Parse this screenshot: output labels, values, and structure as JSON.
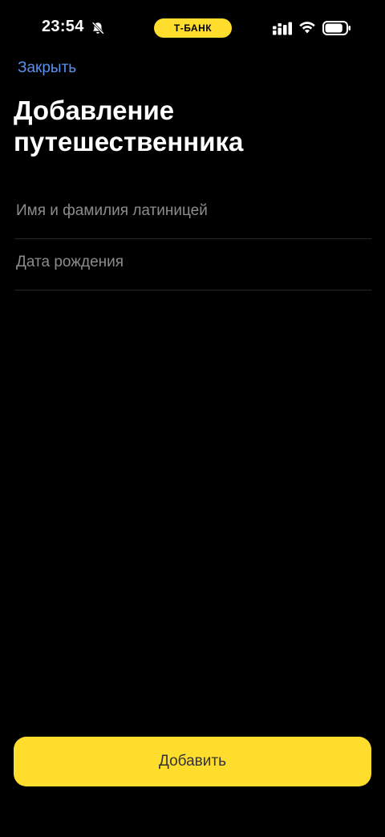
{
  "status_bar": {
    "time": "23:54",
    "bell_icon": "bell-slash-icon",
    "island_label": "Т-БАНК",
    "signal_icon": "cellular-signal-icon",
    "wifi_icon": "wifi-icon",
    "battery_icon": "battery-icon",
    "battery_level": 0.85
  },
  "header": {
    "close_label": "Закрыть",
    "title": "Добавление путешественника"
  },
  "form": {
    "name_placeholder": "Имя и фамилия латиницей",
    "name_value": "",
    "birthdate_placeholder": "Дата рождения",
    "birthdate_value": ""
  },
  "actions": {
    "add_label": "Добавить"
  },
  "colors": {
    "background": "#000000",
    "accent_yellow": "#ffdd2d",
    "link_blue": "#5b8ff0",
    "placeholder_gray": "#8c8c8c"
  }
}
